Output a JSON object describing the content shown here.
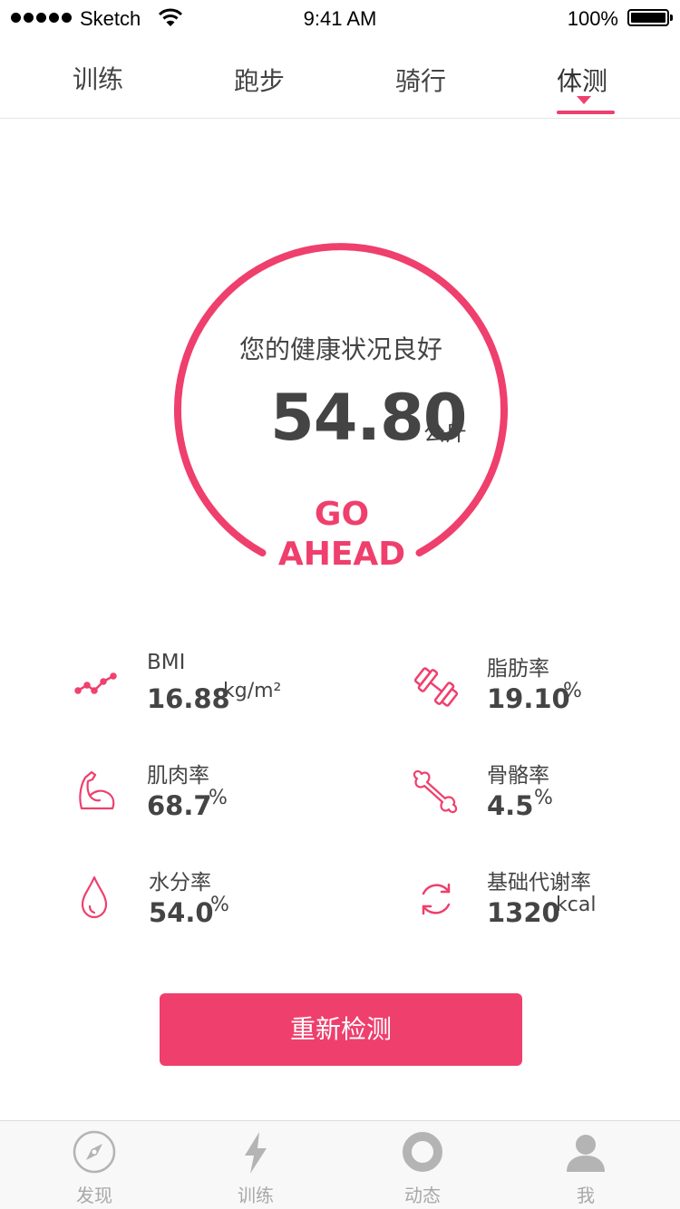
{
  "status_bar": {
    "carrier": "Sketch",
    "time": "9:41 AM",
    "battery": "100%"
  },
  "tabs": [
    {
      "label": "训练",
      "active": false
    },
    {
      "label": "跑步",
      "active": false
    },
    {
      "label": "骑行",
      "active": false
    },
    {
      "label": "体测",
      "active": true
    }
  ],
  "gauge": {
    "status": "您的健康状况良好",
    "weight": "54.80",
    "unit": "公斤",
    "go_line1": "GO",
    "go_line2": "AHEAD"
  },
  "metrics": [
    {
      "label": "BMI",
      "value": "16.88",
      "unit": "kg/m²",
      "icon": "trend-line-icon"
    },
    {
      "label": "脂肪率",
      "value": "19.10",
      "unit": "%",
      "icon": "dumbbell-icon"
    },
    {
      "label": "肌肉率",
      "value": "68.7",
      "unit": "%",
      "icon": "flexed-arm-icon"
    },
    {
      "label": "骨骼率",
      "value": "4.5",
      "unit": "%",
      "icon": "bone-icon"
    },
    {
      "label": "水分率",
      "value": "54.0",
      "unit": "%",
      "icon": "water-drop-icon"
    },
    {
      "label": "基础代谢率",
      "value": "1320",
      "unit": "kcal",
      "icon": "refresh-cycle-icon"
    }
  ],
  "action_button": "重新检测",
  "bottom_nav": [
    {
      "label": "发现",
      "icon": "compass-icon"
    },
    {
      "label": "训练",
      "icon": "lightning-icon"
    },
    {
      "label": "动态",
      "icon": "ring-icon"
    },
    {
      "label": "我",
      "icon": "user-icon"
    }
  ],
  "colors": {
    "accent": "#ef3f6d",
    "text": "#444444",
    "nav_inactive": "#a8a8a8"
  }
}
